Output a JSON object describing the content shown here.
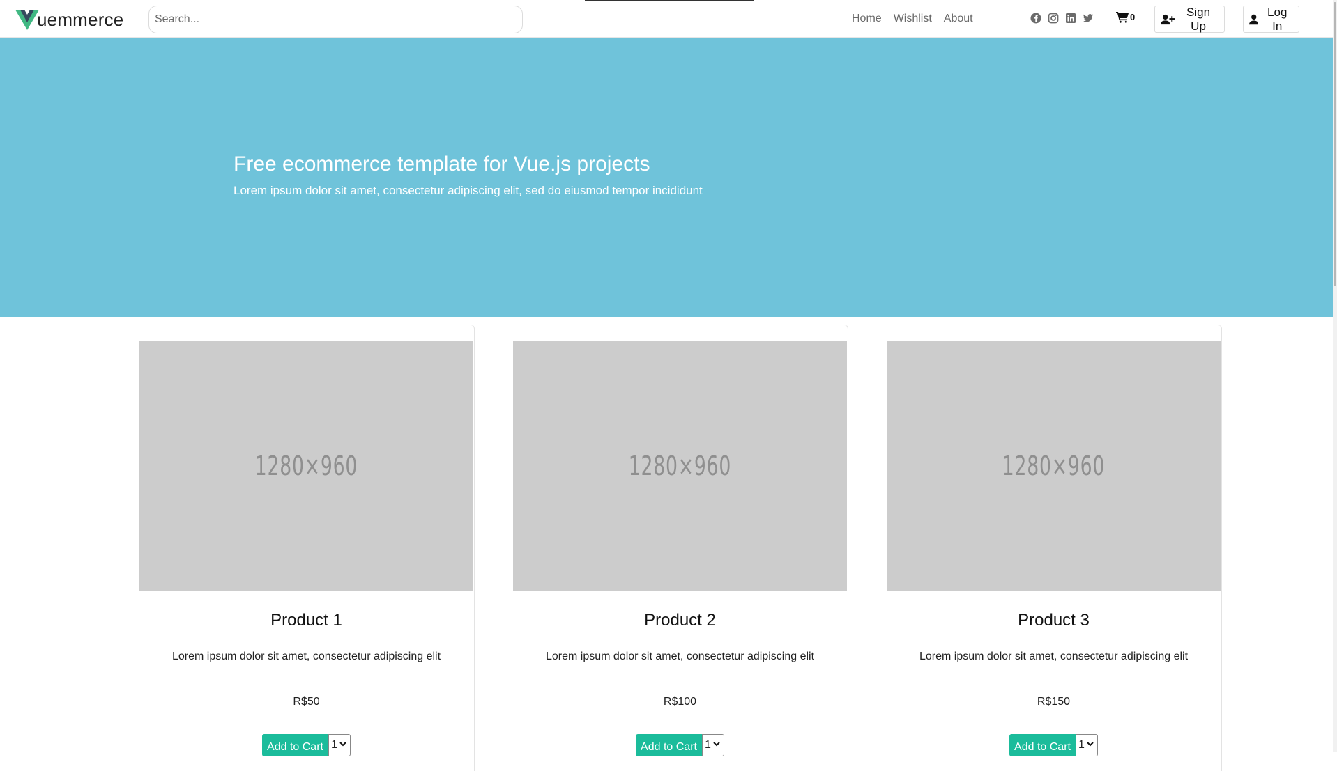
{
  "brand": {
    "logo_letter": "V",
    "name": "uemmerce"
  },
  "search": {
    "placeholder": "Search..."
  },
  "nav": {
    "links": [
      "Home",
      "Wishlist",
      "About"
    ]
  },
  "social": [
    "facebook-icon",
    "instagram-icon",
    "linkedin-icon",
    "twitter-icon"
  ],
  "cart": {
    "count": "0"
  },
  "auth": {
    "signup_label": "Sign Up",
    "login_label": "Log In"
  },
  "hero": {
    "title": "Free ecommerce template for Vue.js projects",
    "subtitle": "Lorem ipsum dolor sit amet, consectetur adipiscing elit, sed do eiusmod tempor incididunt",
    "background": "#6fc3da"
  },
  "colors": {
    "accent": "#1bbc9b",
    "vue_green": "#41b883",
    "vue_dark": "#35495e"
  },
  "products": [
    {
      "image_text": "1280×960",
      "title": "Product 1",
      "description": "Lorem ipsum dolor sit amet, consectetur adipiscing elit",
      "price": "R$50",
      "add_label": "Add to Cart",
      "qty": "1"
    },
    {
      "image_text": "1280×960",
      "title": "Product 2",
      "description": "Lorem ipsum dolor sit amet, consectetur adipiscing elit",
      "price": "R$100",
      "add_label": "Add to Cart",
      "qty": "1"
    },
    {
      "image_text": "1280×960",
      "title": "Product 3",
      "description": "Lorem ipsum dolor sit amet, consectetur adipiscing elit",
      "price": "R$150",
      "add_label": "Add to Cart",
      "qty": "1"
    }
  ]
}
